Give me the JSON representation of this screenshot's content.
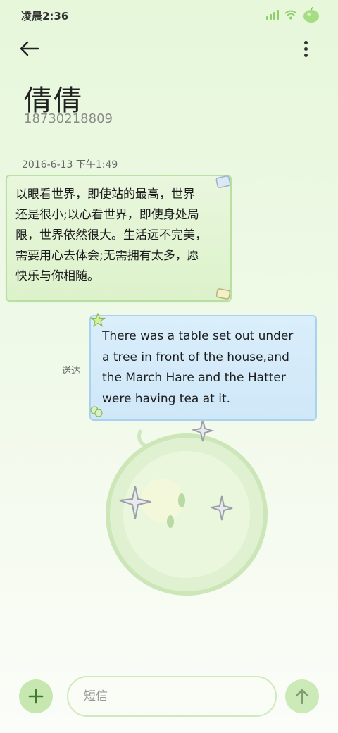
{
  "status_bar": {
    "time": "凌晨2:36",
    "icons": [
      "signal-icon",
      "wifi-icon",
      "apple-battery-icon"
    ]
  },
  "app_bar": {
    "back_icon": "arrow-left-icon",
    "menu_icon": "more-vert-icon"
  },
  "contact": {
    "name": "倩倩",
    "number": "18730218809"
  },
  "conversation": {
    "timestamp": "2016-6-13 下午1:49",
    "messages": [
      {
        "direction": "incoming",
        "lines": [
          "以眼看世界，即使站的最高，世界",
          "还是很小;以心看世界，即使身处局",
          "限，世界依然很大。生活远不完美，",
          "需要用心去体会;无需拥有太多，愿",
          "快乐与你相随。"
        ]
      },
      {
        "direction": "outgoing",
        "status": "送达",
        "lines": [
          "There was a table set out under",
          "a tree in front of the house,and",
          "the March Hare and the Hatter",
          "were having tea at it."
        ]
      }
    ]
  },
  "composer": {
    "add_icon": "plus-icon",
    "placeholder": "短信",
    "value": "",
    "send_icon": "arrow-up-icon"
  },
  "colors": {
    "accent_green": "#c6e8b0",
    "incoming_bubble": "#dcf2cb",
    "outgoing_bubble": "#cfe7f8"
  }
}
